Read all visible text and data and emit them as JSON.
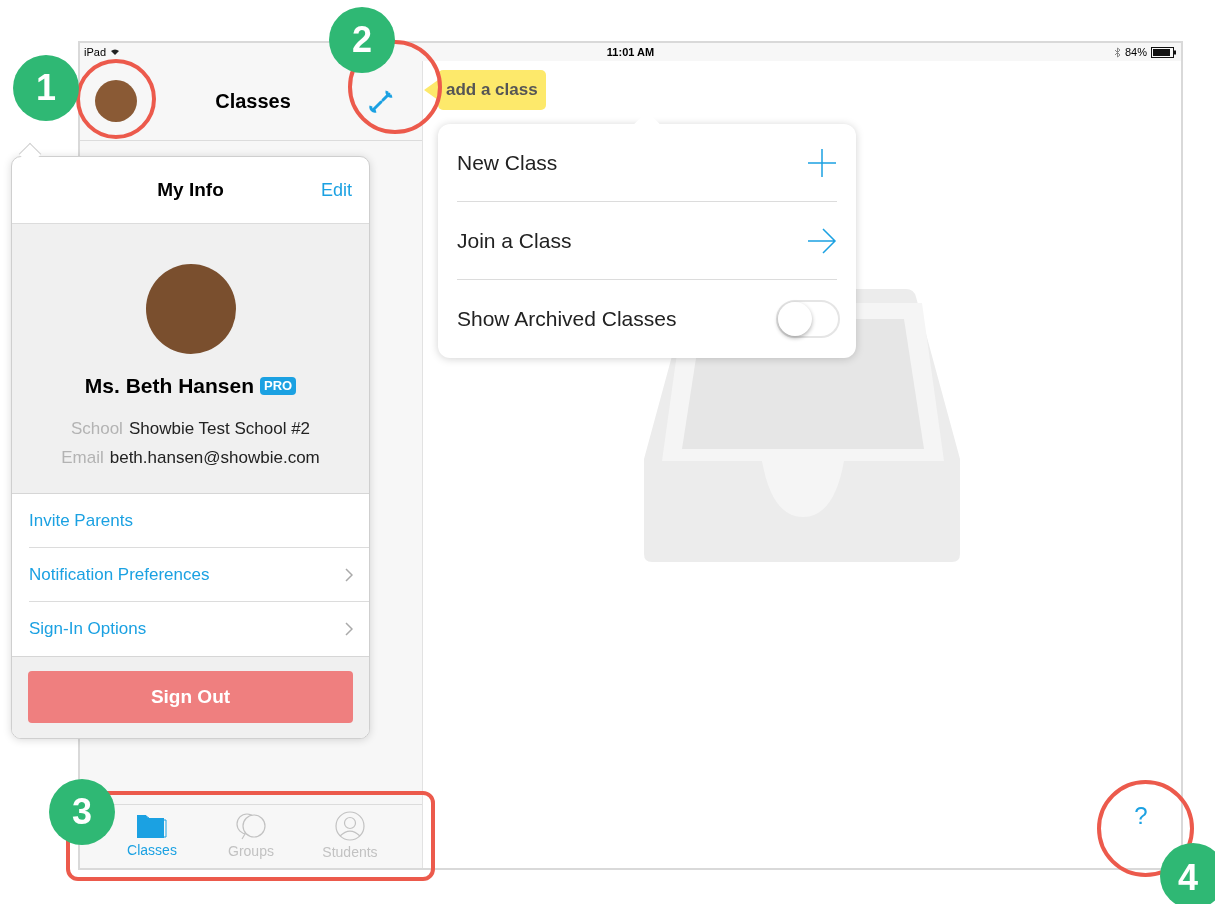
{
  "status_bar": {
    "device": "iPad",
    "time": "11:01 AM",
    "battery": "84%"
  },
  "sidebar": {
    "title": "Classes"
  },
  "tooltip": {
    "text": "add a class"
  },
  "class_menu": {
    "items": [
      {
        "kind": "add",
        "label": "New Class"
      },
      {
        "kind": "join",
        "label": "Join a Class"
      },
      {
        "kind": "toggle",
        "label": "Show Archived Classes",
        "on": false
      }
    ]
  },
  "my_info": {
    "title": "My Info",
    "edit": "Edit",
    "name": "Ms. Beth Hansen",
    "badge": "PRO",
    "fields": [
      {
        "label": "School",
        "value": "Showbie Test School #2"
      },
      {
        "label": "Email",
        "value": "beth.hansen@showbie.com"
      }
    ],
    "links": [
      {
        "label": "Invite Parents",
        "chevron": false
      },
      {
        "label": "Notification Preferences",
        "chevron": true
      },
      {
        "label": "Sign-In Options",
        "chevron": true
      }
    ],
    "sign_out": "Sign Out"
  },
  "tab_bar": [
    {
      "kind": "folder",
      "label": "Classes",
      "selected": true
    },
    {
      "kind": "chat",
      "label": "Groups",
      "selected": false
    },
    {
      "kind": "person",
      "label": "Students",
      "selected": false
    }
  ],
  "help": "?",
  "callouts": [
    "1",
    "2",
    "3",
    "4"
  ]
}
